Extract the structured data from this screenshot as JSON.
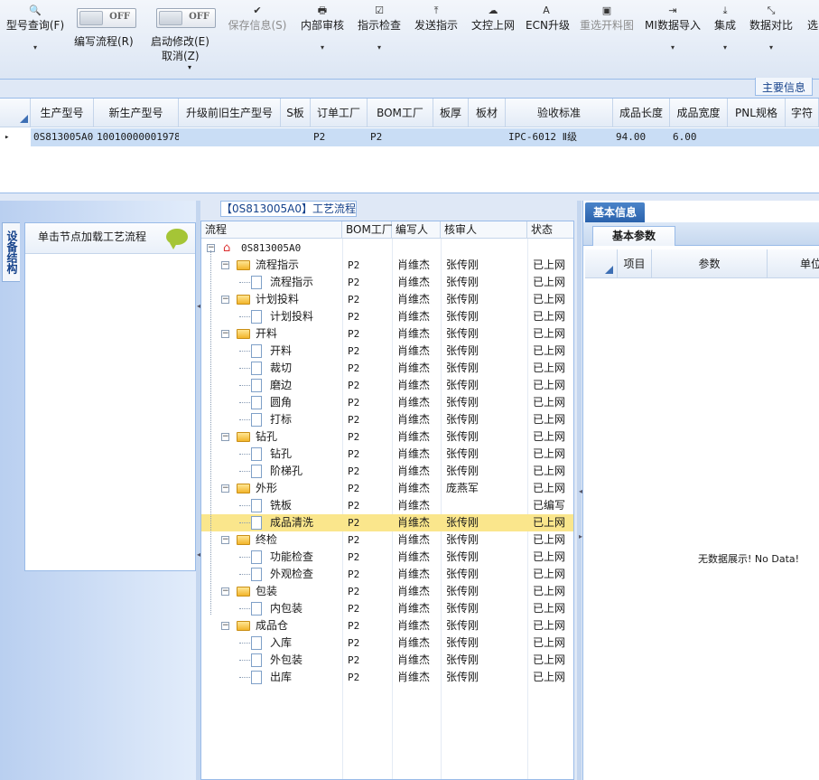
{
  "toolbar": {
    "buttons": [
      {
        "label": "型号查询(F)",
        "icon": "search-icon",
        "glyph": "🔍",
        "dropdown": "▾"
      },
      {
        "label": "保存信息(S)",
        "icon": "check-icon",
        "glyph": "✔",
        "disabled": true
      },
      {
        "label": "内部审核",
        "icon": "print-icon",
        "glyph": "🖶",
        "dropdown": "▾"
      },
      {
        "label": "指示检查",
        "icon": "checkbox-icon",
        "glyph": "☑",
        "dropdown": "▾"
      },
      {
        "label": "发送指示",
        "icon": "upload-icon",
        "glyph": "⤒"
      },
      {
        "label": "文控上网",
        "icon": "cloud-upload-icon",
        "glyph": "☁"
      },
      {
        "label": "ECN升级",
        "icon": "font-icon",
        "glyph": "A"
      },
      {
        "label": "重选开料图",
        "icon": "image-icon",
        "glyph": "▣",
        "disabled": true
      },
      {
        "label": "MI数据导入",
        "icon": "import-icon",
        "glyph": "⇥",
        "dropdown": "▾"
      },
      {
        "label": "集成",
        "icon": "download-icon",
        "glyph": "⤓",
        "dropdown": "▾"
      },
      {
        "label": "数据对比",
        "icon": "compress-icon",
        "glyph": "⤡",
        "dropdown": "▾"
      },
      {
        "label": "选",
        "icon": "",
        "glyph": ""
      }
    ],
    "toggle_write": {
      "state": "OFF",
      "label": "编写流程(R)"
    },
    "toggle_modify": {
      "state": "OFF",
      "label": "启动修改(E)",
      "sublabel": "取消(Z)",
      "dropdown": "▾"
    }
  },
  "main_info_tab": "主要信息",
  "grid": {
    "columns": [
      "生产型号",
      "新生产型号",
      "升级前旧生产型号",
      "S板",
      "订单工厂",
      "BOM工厂",
      "板厚",
      "板材",
      "验收标准",
      "成品长度",
      "成品宽度",
      "PNL规格",
      "字符"
    ],
    "rows": [
      {
        "cells": [
          "0S813005A0",
          "10010000001978",
          "",
          "",
          "P2",
          "P2",
          "",
          "",
          "IPC-6012 Ⅱ级",
          "94.00",
          "6.00",
          "",
          ""
        ]
      }
    ],
    "row_marker": "▸"
  },
  "left": {
    "vertical_tab": "设备结构",
    "load_hint": "单击节点加载工艺流程"
  },
  "flow": {
    "title": "【0S813005A0】工艺流程",
    "columns": [
      "流程",
      "BOM工厂",
      "编写人",
      "核审人",
      "状态"
    ],
    "root": "0S813005A0",
    "rows": [
      {
        "name": "流程指示",
        "level": 1,
        "factory": "P2",
        "writer": "肖维杰",
        "reviewer": "张传刚",
        "status": "已上网"
      },
      {
        "name": "流程指示",
        "level": 2,
        "factory": "P2",
        "writer": "肖维杰",
        "reviewer": "张传刚",
        "status": "已上网"
      },
      {
        "name": "计划投料",
        "level": 1,
        "factory": "P2",
        "writer": "肖维杰",
        "reviewer": "张传刚",
        "status": "已上网"
      },
      {
        "name": "计划投料",
        "level": 2,
        "factory": "P2",
        "writer": "肖维杰",
        "reviewer": "张传刚",
        "status": "已上网"
      },
      {
        "name": "开料",
        "level": 1,
        "factory": "P2",
        "writer": "肖维杰",
        "reviewer": "张传刚",
        "status": "已上网"
      },
      {
        "name": "开料",
        "level": 2,
        "factory": "P2",
        "writer": "肖维杰",
        "reviewer": "张传刚",
        "status": "已上网"
      },
      {
        "name": "裁切",
        "level": 2,
        "factory": "P2",
        "writer": "肖维杰",
        "reviewer": "张传刚",
        "status": "已上网"
      },
      {
        "name": "磨边",
        "level": 2,
        "factory": "P2",
        "writer": "肖维杰",
        "reviewer": "张传刚",
        "status": "已上网"
      },
      {
        "name": "圆角",
        "level": 2,
        "factory": "P2",
        "writer": "肖维杰",
        "reviewer": "张传刚",
        "status": "已上网"
      },
      {
        "name": "打标",
        "level": 2,
        "factory": "P2",
        "writer": "肖维杰",
        "reviewer": "张传刚",
        "status": "已上网"
      },
      {
        "name": "钻孔",
        "level": 1,
        "factory": "P2",
        "writer": "肖维杰",
        "reviewer": "张传刚",
        "status": "已上网"
      },
      {
        "name": "钻孔",
        "level": 2,
        "factory": "P2",
        "writer": "肖维杰",
        "reviewer": "张传刚",
        "status": "已上网"
      },
      {
        "name": "阶梯孔",
        "level": 2,
        "factory": "P2",
        "writer": "肖维杰",
        "reviewer": "张传刚",
        "status": "已上网"
      },
      {
        "name": "外形",
        "level": 1,
        "factory": "P2",
        "writer": "肖维杰",
        "reviewer": "庞燕军",
        "status": "已上网"
      },
      {
        "name": "铣板",
        "level": 2,
        "factory": "P2",
        "writer": "肖维杰",
        "reviewer": "",
        "status": "已编写"
      },
      {
        "name": "成品清洗",
        "level": 2,
        "factory": "P2",
        "writer": "肖维杰",
        "reviewer": "张传刚",
        "status": "已上网",
        "selected": true
      },
      {
        "name": "终检",
        "level": 1,
        "factory": "P2",
        "writer": "肖维杰",
        "reviewer": "张传刚",
        "status": "已上网"
      },
      {
        "name": "功能检查",
        "level": 2,
        "factory": "P2",
        "writer": "肖维杰",
        "reviewer": "张传刚",
        "status": "已上网"
      },
      {
        "name": "外观检查",
        "level": 2,
        "factory": "P2",
        "writer": "肖维杰",
        "reviewer": "张传刚",
        "status": "已上网"
      },
      {
        "name": "包装",
        "level": 1,
        "factory": "P2",
        "writer": "肖维杰",
        "reviewer": "张传刚",
        "status": "已上网"
      },
      {
        "name": "内包装",
        "level": 2,
        "factory": "P2",
        "writer": "肖维杰",
        "reviewer": "张传刚",
        "status": "已上网"
      },
      {
        "name": "成品仓",
        "level": 1,
        "factory": "P2",
        "writer": "肖维杰",
        "reviewer": "张传刚",
        "status": "已上网"
      },
      {
        "name": "入库",
        "level": 2,
        "factory": "P2",
        "writer": "肖维杰",
        "reviewer": "张传刚",
        "status": "已上网"
      },
      {
        "name": "外包装",
        "level": 2,
        "factory": "P2",
        "writer": "肖维杰",
        "reviewer": "张传刚",
        "status": "已上网"
      },
      {
        "name": "出库",
        "level": 2,
        "factory": "P2",
        "writer": "肖维杰",
        "reviewer": "张传刚",
        "status": "已上网"
      }
    ]
  },
  "right": {
    "tab": "基本信息",
    "subtab": "基本参数",
    "columns": [
      "项目",
      "参数",
      "单位"
    ],
    "empty_text": "无数据展示! No Data!"
  },
  "colors": {
    "accent": "#2a62ac",
    "selected_row": "#fae68c",
    "grid_selected": "#c9ddf5"
  }
}
